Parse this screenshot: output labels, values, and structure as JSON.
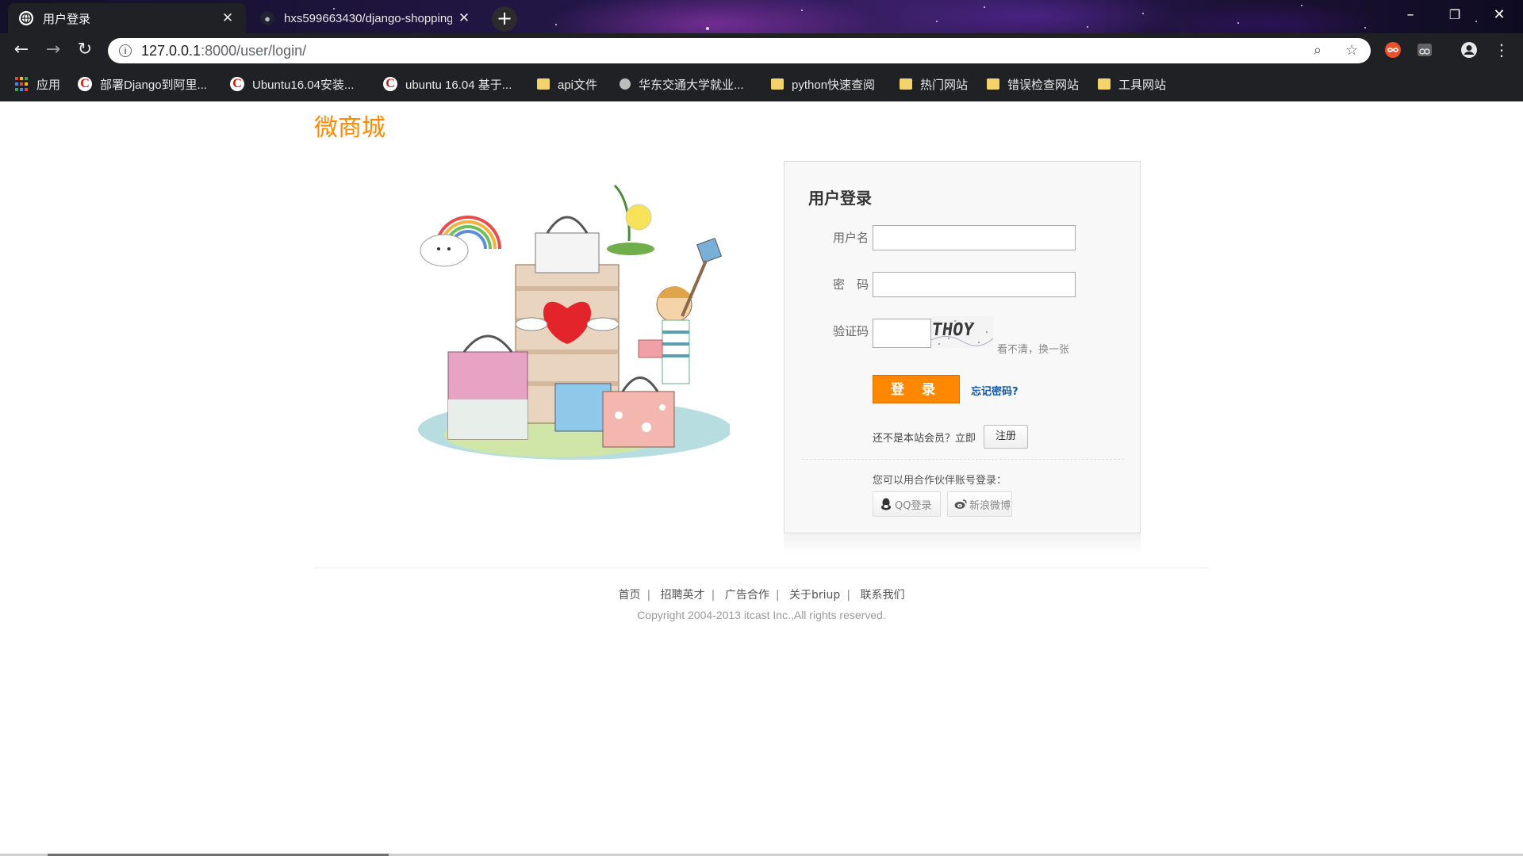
{
  "browser": {
    "tabs": [
      {
        "title": "用户登录",
        "active": true,
        "icon": "globe-icon"
      },
      {
        "title": "hxs599663430/django-shopping",
        "active": false,
        "icon": "github-icon"
      }
    ],
    "new_tab": "+",
    "window_controls": {
      "minimize": "–",
      "restore": "❐",
      "close": "✕"
    },
    "url_host": "127.0.0.1",
    "url_rest": ":8000/user/login/",
    "bookmarks": [
      {
        "label": "应用",
        "icon": "apps-icon"
      },
      {
        "label": "部署Django到阿里...",
        "icon": "csdn-icon"
      },
      {
        "label": "Ubuntu16.04安装...",
        "icon": "csdn-icon"
      },
      {
        "label": "ubuntu 16.04 基于...",
        "icon": "csdn-icon"
      },
      {
        "label": "api文件",
        "icon": "folder-icon"
      },
      {
        "label": "华东交通大学就业...",
        "icon": "site-icon"
      },
      {
        "label": "python快速查阅",
        "icon": "folder-icon"
      },
      {
        "label": "热门网站",
        "icon": "folder-icon"
      },
      {
        "label": "错误检查网站",
        "icon": "folder-icon"
      },
      {
        "label": "工具网站",
        "icon": "folder-icon"
      }
    ]
  },
  "page": {
    "logo": "微商城",
    "login": {
      "title": "用户登录",
      "username_label": "用户名",
      "password_label": "密　码",
      "captcha_label": "验证码",
      "captcha_text": "THOY",
      "captcha_refresh": "看不清，换一张",
      "submit": "登 录",
      "forgot": "忘记密码?",
      "register_tip": "还不是本站会员？立即",
      "register_button": "注册",
      "partner_tip": "您可以用合作伙伴账号登录：",
      "qq_login": "QQ登录",
      "weibo_login": "新浪微博"
    },
    "footer": {
      "links": [
        "首页",
        "招聘英才",
        "广告合作",
        "关于briup",
        "联系我们"
      ],
      "copyright": "Copyright 2004-2013 itcast Inc.,All rights reserved."
    }
  },
  "colors": {
    "accent": "#ff8800",
    "link": "#1155aa",
    "chrome_dark": "#202124"
  }
}
